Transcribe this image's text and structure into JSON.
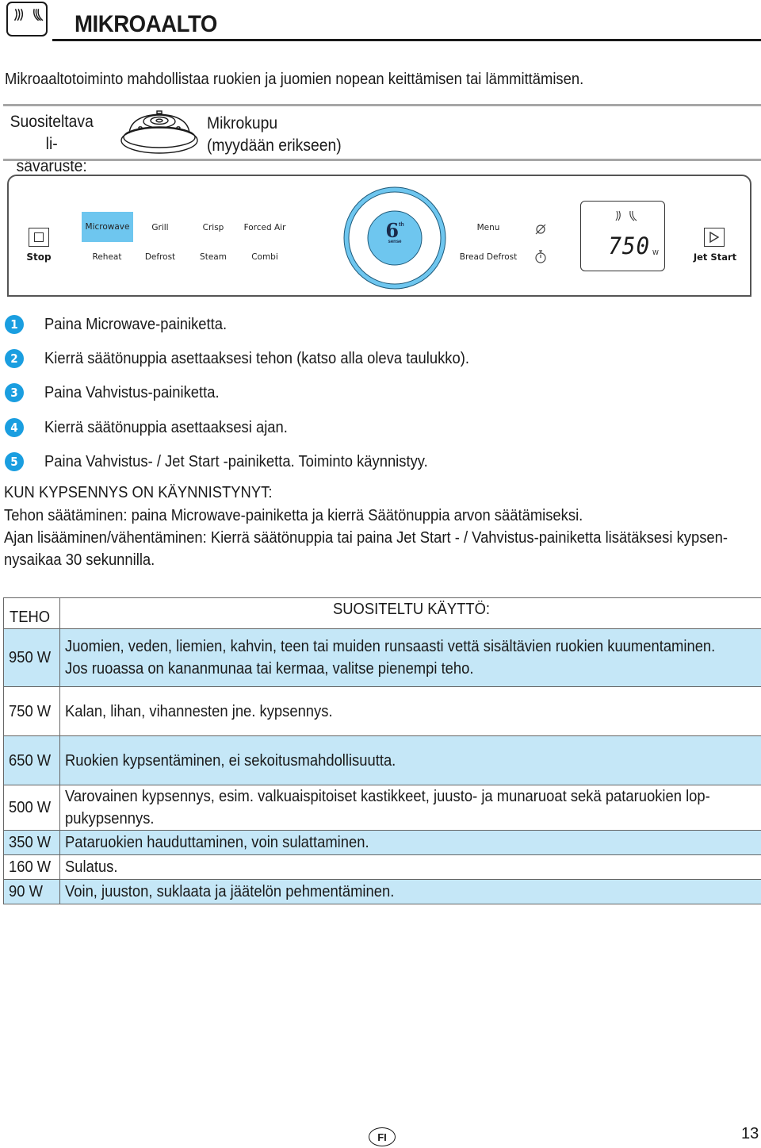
{
  "header": {
    "icon": "microwave-waves-icon",
    "title": "MIKROAALTO"
  },
  "intro": "Mikroaaltotoiminto mahdollistaa ruokien ja juomien nopean keittämisen tai lämmittämisen.",
  "accessory": {
    "label_line1": "Suositeltava li-",
    "label_line2": "sävaruste:",
    "image": "microwave-cover-icon",
    "name_line1": "Mikrokupu",
    "name_line2": "(myydään erikseen)"
  },
  "control_panel": {
    "stop_label": "Stop",
    "functions_top": [
      "Microwave",
      "Grill",
      "Crisp",
      "Forced Air"
    ],
    "functions_bottom": [
      "Reheat",
      "Defrost",
      "Steam",
      "Combi"
    ],
    "active_function": "Microwave",
    "knob_logo_main": "6",
    "knob_logo_sup": "th",
    "knob_logo_sub": "sense",
    "menu_label": "Menu",
    "bread_defrost_label": "Bread Defrost",
    "display_value": "750",
    "display_unit": "W",
    "jet_start_label": "Jet Start",
    "accent_color": "#6ec6ef"
  },
  "steps": [
    {
      "num": "1",
      "text": "Paina Microwave-painiketta."
    },
    {
      "num": "2",
      "text": "Kierrä säätönuppia asettaaksesi tehon (katso alla oleva taulukko)."
    },
    {
      "num": "3",
      "text": "Paina Vahvistus-painiketta."
    },
    {
      "num": "4",
      "text": "Kierrä säätönuppia  asettaaksesi ajan."
    },
    {
      "num": "5",
      "text": "Paina Vahvistus- / Jet Start -painiketta. Toiminto käynnistyy."
    }
  ],
  "during_cooking": {
    "heading": "KUN KYPSENNYS ON KÄYNNISTYNYT:",
    "line1": "Tehon säätäminen: paina Microwave-painiketta ja kierrä Säätönuppia arvon säätämiseksi.",
    "line2": "Ajan lisääminen/vähentäminen: Kierrä säätönuppia tai paina Jet Start - / Vahvistus-painiketta lisätäksesi kypsen-",
    "line3": "nysaikaa 30 sekunnilla."
  },
  "table": {
    "header_power": "TEHO",
    "header_use": "SUOSITELTU KÄYTTÖ:",
    "rows": [
      {
        "power": "950 W",
        "use": [
          "Juomien, veden, liemien, kahvin, teen tai muiden runsaasti vettä sisältävien ruokien kuumentaminen.",
          "Jos ruoassa on kananmunaa tai kermaa, valitse pienempi teho."
        ]
      },
      {
        "power": "750 W",
        "use": [
          "Kalan, lihan, vihannesten jne. kypsennys."
        ]
      },
      {
        "power": "650 W",
        "use": [
          "Ruokien kypsentäminen, ei sekoitusmahdollisuutta."
        ]
      },
      {
        "power": "500 W",
        "use": [
          "Varovainen kypsennys, esim. valkuaispitoiset kastikkeet, juusto- ja munaruoat sekä pataruokien lop-",
          "pukypsennys."
        ]
      },
      {
        "power": "350 W",
        "use": [
          "Pataruokien hauduttaminen, voin sulattaminen."
        ]
      },
      {
        "power": "160 W",
        "use": [
          "Sulatus."
        ]
      },
      {
        "power": "90 W",
        "use": [
          "Voin, juuston, suklaata ja jäätelön pehmentäminen."
        ]
      }
    ],
    "row_highlight_color": "#c5e7f7"
  },
  "footer": {
    "language_badge": "FI",
    "page_number": "13"
  }
}
